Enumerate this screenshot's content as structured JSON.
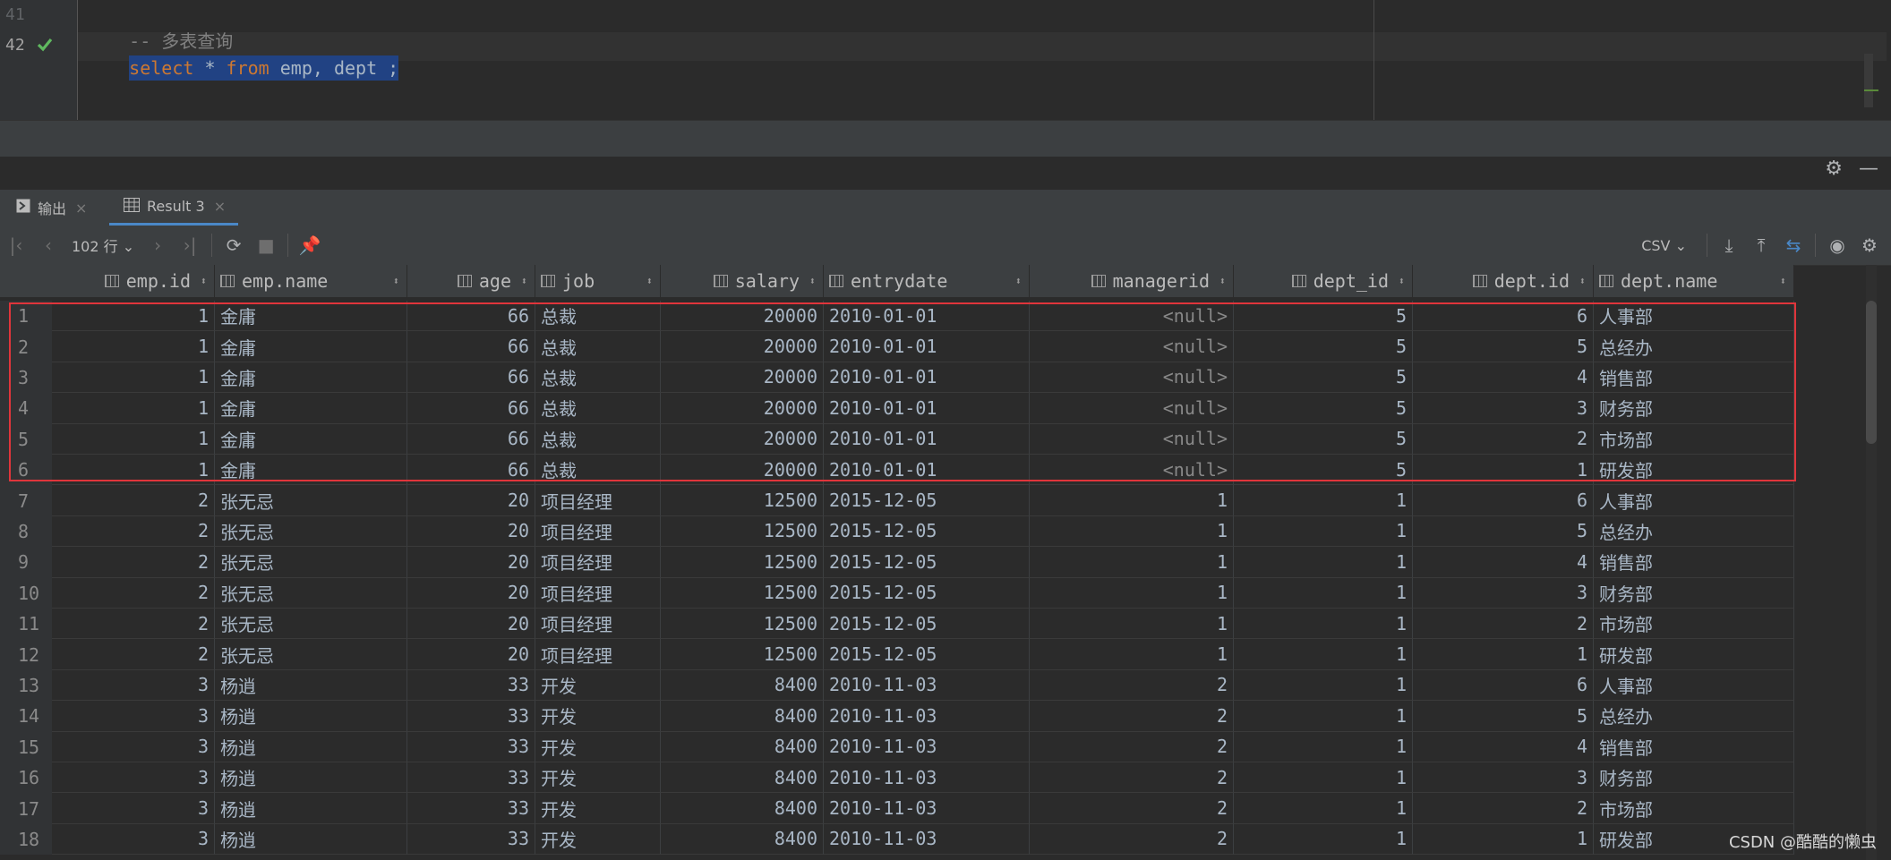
{
  "editor": {
    "lines": [
      {
        "num": "41",
        "comment": "-- 多表查询"
      },
      {
        "num": "42",
        "sql_kw1": "select",
        "sql_star": " * ",
        "sql_kw2": "from",
        "sql_rest": " emp, dept ;"
      }
    ]
  },
  "tabs": [
    {
      "label": "输出",
      "icon": "console-icon"
    },
    {
      "label": "Result 3",
      "icon": "table-icon"
    }
  ],
  "toolbar": {
    "rows_label": "102 行",
    "export_format": "CSV"
  },
  "columns": [
    "emp.id",
    "emp.name",
    "age",
    "job",
    "salary",
    "entrydate",
    "managerid",
    "dept_id",
    "dept.id",
    "dept.name"
  ],
  "rows": [
    [
      "1",
      "1",
      "金庸",
      "66",
      "总裁",
      "20000",
      "2010-01-01",
      "<null>",
      "5",
      "6",
      "人事部"
    ],
    [
      "2",
      "1",
      "金庸",
      "66",
      "总裁",
      "20000",
      "2010-01-01",
      "<null>",
      "5",
      "5",
      "总经办"
    ],
    [
      "3",
      "1",
      "金庸",
      "66",
      "总裁",
      "20000",
      "2010-01-01",
      "<null>",
      "5",
      "4",
      "销售部"
    ],
    [
      "4",
      "1",
      "金庸",
      "66",
      "总裁",
      "20000",
      "2010-01-01",
      "<null>",
      "5",
      "3",
      "财务部"
    ],
    [
      "5",
      "1",
      "金庸",
      "66",
      "总裁",
      "20000",
      "2010-01-01",
      "<null>",
      "5",
      "2",
      "市场部"
    ],
    [
      "6",
      "1",
      "金庸",
      "66",
      "总裁",
      "20000",
      "2010-01-01",
      "<null>",
      "5",
      "1",
      "研发部"
    ],
    [
      "7",
      "2",
      "张无忌",
      "20",
      "项目经理",
      "12500",
      "2015-12-05",
      "1",
      "1",
      "6",
      "人事部"
    ],
    [
      "8",
      "2",
      "张无忌",
      "20",
      "项目经理",
      "12500",
      "2015-12-05",
      "1",
      "1",
      "5",
      "总经办"
    ],
    [
      "9",
      "2",
      "张无忌",
      "20",
      "项目经理",
      "12500",
      "2015-12-05",
      "1",
      "1",
      "4",
      "销售部"
    ],
    [
      "10",
      "2",
      "张无忌",
      "20",
      "项目经理",
      "12500",
      "2015-12-05",
      "1",
      "1",
      "3",
      "财务部"
    ],
    [
      "11",
      "2",
      "张无忌",
      "20",
      "项目经理",
      "12500",
      "2015-12-05",
      "1",
      "1",
      "2",
      "市场部"
    ],
    [
      "12",
      "2",
      "张无忌",
      "20",
      "项目经理",
      "12500",
      "2015-12-05",
      "1",
      "1",
      "1",
      "研发部"
    ],
    [
      "13",
      "3",
      "杨逍",
      "33",
      "开发",
      "8400",
      "2010-11-03",
      "2",
      "1",
      "6",
      "人事部"
    ],
    [
      "14",
      "3",
      "杨逍",
      "33",
      "开发",
      "8400",
      "2010-11-03",
      "2",
      "1",
      "5",
      "总经办"
    ],
    [
      "15",
      "3",
      "杨逍",
      "33",
      "开发",
      "8400",
      "2010-11-03",
      "2",
      "1",
      "4",
      "销售部"
    ],
    [
      "16",
      "3",
      "杨逍",
      "33",
      "开发",
      "8400",
      "2010-11-03",
      "2",
      "1",
      "3",
      "财务部"
    ],
    [
      "17",
      "3",
      "杨逍",
      "33",
      "开发",
      "8400",
      "2010-11-03",
      "2",
      "1",
      "2",
      "市场部"
    ],
    [
      "18",
      "3",
      "杨逍",
      "33",
      "开发",
      "8400",
      "2010-11-03",
      "2",
      "1",
      "1",
      "研发部"
    ]
  ],
  "watermark": "CSDN @酷酷的懒虫"
}
